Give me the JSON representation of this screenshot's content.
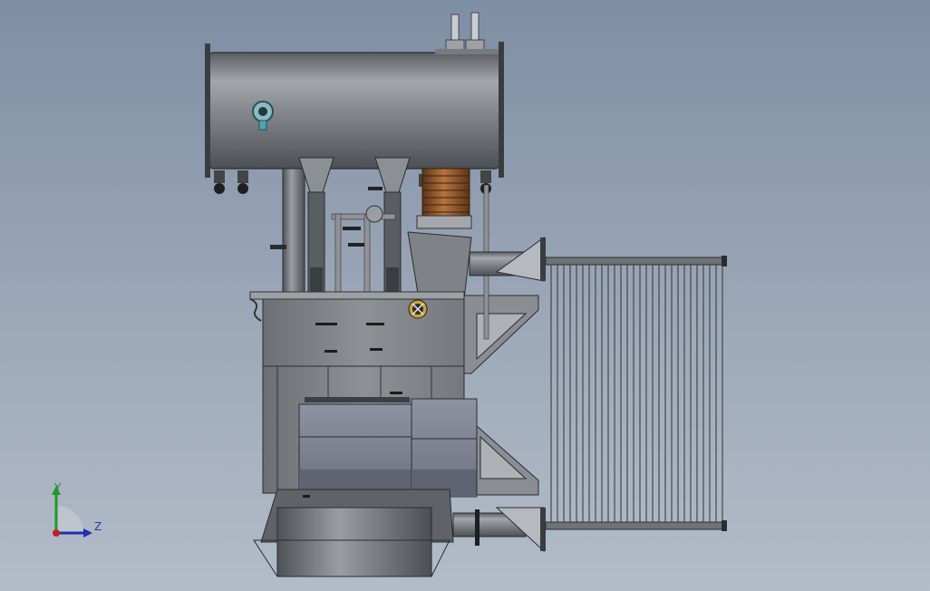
{
  "viewport": {
    "background_top": "#7e8ea4",
    "background_bottom": "#b3bcc8"
  },
  "model": {
    "name_icon": "transformer-3d-model",
    "parts": [
      "conservator-tank",
      "main-tank",
      "radiator-bank",
      "hv-bushing",
      "support-brackets",
      "base-frame",
      "valves",
      "pipework"
    ]
  },
  "triad": {
    "y_label": "Y",
    "z_label": "Z",
    "y_color": "#1f9a2a",
    "z_color": "#1f2fb0",
    "x_color": "#c02020"
  }
}
